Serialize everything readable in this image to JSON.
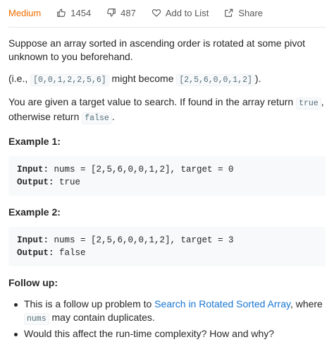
{
  "toolbar": {
    "difficulty": "Medium",
    "likes": "1454",
    "dislikes": "487",
    "add_to_list": "Add to List",
    "share": "Share"
  },
  "description": {
    "p1": "Suppose an array sorted in ascending order is rotated at some pivot unknown to you beforehand.",
    "p2_prefix": "(i.e., ",
    "p2_code1": "[0,0,1,2,2,5,6]",
    "p2_middle": " might become ",
    "p2_code2": "[2,5,6,0,0,1,2]",
    "p2_suffix": ").",
    "p3_prefix": "You are given a target value to search. If found in the array return ",
    "p3_code1": "true",
    "p3_middle": ", otherwise return ",
    "p3_code2": "false",
    "p3_suffix": "."
  },
  "examples": [
    {
      "heading": "Example 1:",
      "input_label": "Input:",
      "input_value": " nums = [2,5,6,0,0,1,2], target = 0",
      "output_label": "Output:",
      "output_value": " true"
    },
    {
      "heading": "Example 2:",
      "input_label": "Input:",
      "input_value": " nums = [2,5,6,0,0,1,2], target = 3",
      "output_label": "Output:",
      "output_value": " false"
    }
  ],
  "followup": {
    "heading": "Follow up:",
    "item1_prefix": "This is a follow up problem to ",
    "item1_link": "Search in Rotated Sorted Array",
    "item1_middle": ", where ",
    "item1_code": "nums",
    "item1_suffix": " may contain duplicates.",
    "item2": "Would this affect the run-time complexity? How and why?"
  },
  "colors": {
    "difficulty": "#ef6c00",
    "link": "#1976d2",
    "code_text": "#546e7a"
  },
  "icons": {
    "like": "thumbs-up-icon",
    "dislike": "thumbs-down-icon",
    "add_to_list": "heart-icon",
    "share": "share-icon"
  }
}
